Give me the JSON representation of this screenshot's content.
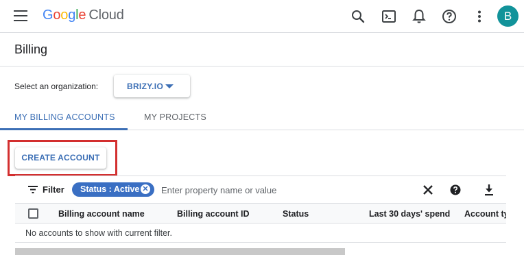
{
  "app": {
    "logo_letters": [
      "G",
      "o",
      "o",
      "g",
      "l",
      "e"
    ],
    "logo_product": "Cloud",
    "avatar_initial": "B",
    "icons": [
      "menu-icon",
      "search-icon",
      "cloud-shell-icon",
      "notifications-icon",
      "help-icon",
      "more-vert-icon"
    ]
  },
  "page": {
    "title": "Billing"
  },
  "organization": {
    "label": "Select an organization:",
    "selected": "BRIZY.IO"
  },
  "tabs": [
    {
      "label": "MY BILLING ACCOUNTS",
      "active": true
    },
    {
      "label": "MY PROJECTS",
      "active": false
    }
  ],
  "actions": {
    "create_account": "CREATE ACCOUNT",
    "highlight_color": "#d32f2f"
  },
  "filter": {
    "label": "Filter",
    "chip": "Status : Active",
    "placeholder": "Enter property name or value",
    "icons": [
      "filter-icon",
      "clear-icon",
      "help-icon",
      "download-icon"
    ]
  },
  "table": {
    "columns": [
      "Billing account name",
      "Billing account ID",
      "Status",
      "Last 30 days' spend",
      "Account typ"
    ],
    "empty_message": "No accounts to show with current filter."
  },
  "colors": {
    "accent": "#3c6fb5",
    "chip": "#3a6fc3",
    "avatar": "#12939a"
  }
}
